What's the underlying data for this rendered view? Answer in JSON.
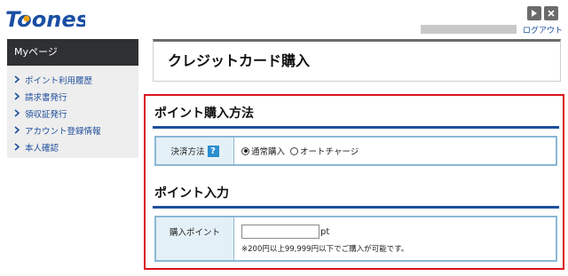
{
  "logo": {
    "text": "Toones"
  },
  "header": {
    "logout_label": "ログアウト"
  },
  "sidebar": {
    "title": "Myページ",
    "items": [
      {
        "label": "ポイント利用履歴"
      },
      {
        "label": "請求書発行"
      },
      {
        "label": "領収証発行"
      },
      {
        "label": "アカウント登録情報"
      },
      {
        "label": "本人確認"
      }
    ]
  },
  "page": {
    "title": "クレジットカード購入"
  },
  "payment_section": {
    "title": "ポイント購入方法",
    "field_label": "決済方法",
    "help_label": "?",
    "options": [
      {
        "label": "通常購入",
        "selected": true
      },
      {
        "label": "オートチャージ",
        "selected": false
      }
    ]
  },
  "points_section": {
    "title": "ポイント入力",
    "field_label": "購入ポイント",
    "input_value": "",
    "unit": "pt",
    "note": "※200円以上99,999円以下でご購入が可能です。"
  },
  "colors": {
    "accent_blue": "#1d4f9c",
    "highlight_red": "#d9141e",
    "sidebar_header": "#2f3032"
  }
}
